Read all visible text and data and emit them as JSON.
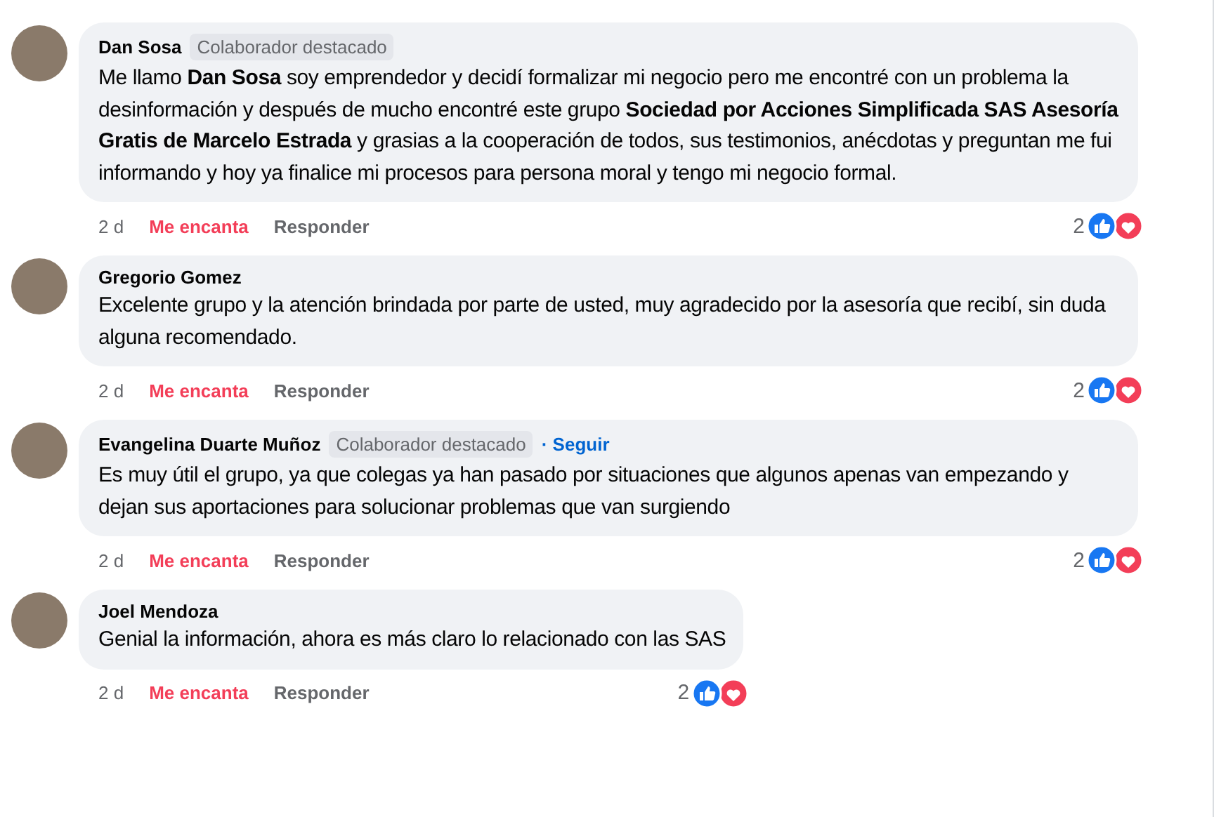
{
  "comments": [
    {
      "author": "Dan Sosa",
      "badge": "Colaborador destacado",
      "text": "Me llamo **Dan Sosa** soy emprendedor y decidí formalizar mi negocio pero me encontré con un problema la desinformación y después de mucho encontré este grupo **Sociedad por Acciones Simplificada SAS Asesoría Gratis de Marcelo Estrada** y grasias a la cooperación de todos, sus testimonios, anécdotas y preguntan me fui informando y hoy ya finalice mi procesos para persona moral y tengo mi negocio formal.",
      "time": "2 d",
      "love_label": "Me encanta",
      "reacted": true,
      "reply_label": "Responder",
      "reaction_count": "2"
    },
    {
      "author": "Gregorio Gomez",
      "text": "Excelente grupo y la atención brindada por parte de usted, muy agradecido por la asesoría que recibí, sin duda alguna recomendado.",
      "time": "2 d",
      "love_label": "Me encanta",
      "reacted": true,
      "reply_label": "Responder",
      "reaction_count": "2"
    },
    {
      "author": "Evangelina Duarte Muñoz",
      "badge": "Colaborador destacado",
      "follow": "· Seguir",
      "text": "Es muy útil el grupo, ya que colegas ya han pasado por situaciones que algunos apenas van empezando y dejan sus aportaciones para solucionar problemas que van surgiendo",
      "time": "2 d",
      "love_label": "Me encanta",
      "reacted": true,
      "reply_label": "Responder",
      "reaction_count": "2"
    },
    {
      "author": "Joel Mendoza",
      "text": "Genial la información, ahora es más claro lo relacionado con las SAS",
      "time": "2 d",
      "love_label": "Me encanta",
      "reacted": true,
      "reply_label": "Responder",
      "reaction_count": "2"
    }
  ]
}
